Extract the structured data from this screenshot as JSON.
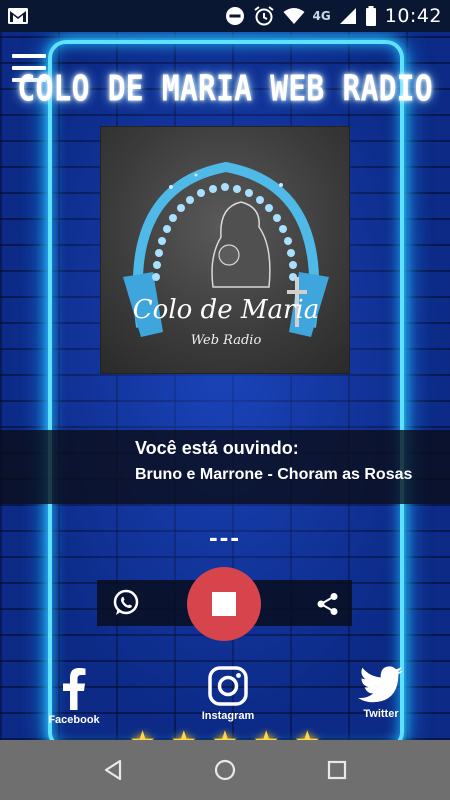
{
  "status_bar": {
    "time": "10:42",
    "network": "4G",
    "icons": [
      "gmail-icon",
      "do-not-disturb-icon",
      "alarm-icon",
      "wifi-icon",
      "signal-icon",
      "battery-icon"
    ]
  },
  "app": {
    "title": "COLO DE MARIA WEB RADIO",
    "logo": {
      "name": "Colo de Maria",
      "subtitle": "Web Radio"
    },
    "now_playing": {
      "label": "Você está ouvindo:",
      "track": "Bruno e Marrone - Choram as Rosas"
    },
    "status_text": "---",
    "controls": {
      "left": "whatsapp-icon",
      "center": "stop-icon",
      "right": "share-icon"
    },
    "social": [
      {
        "label": "Facebook",
        "icon": "facebook-icon"
      },
      {
        "label": "Instagram",
        "icon": "instagram-icon"
      },
      {
        "label": "Twitter",
        "icon": "twitter-icon"
      }
    ],
    "rating": {
      "stars": 5
    }
  },
  "colors": {
    "neon": "#5fe2ff",
    "stop_button": "#d8444b",
    "star": "#ffd84a",
    "nav_bar": "#6f6f6f"
  }
}
